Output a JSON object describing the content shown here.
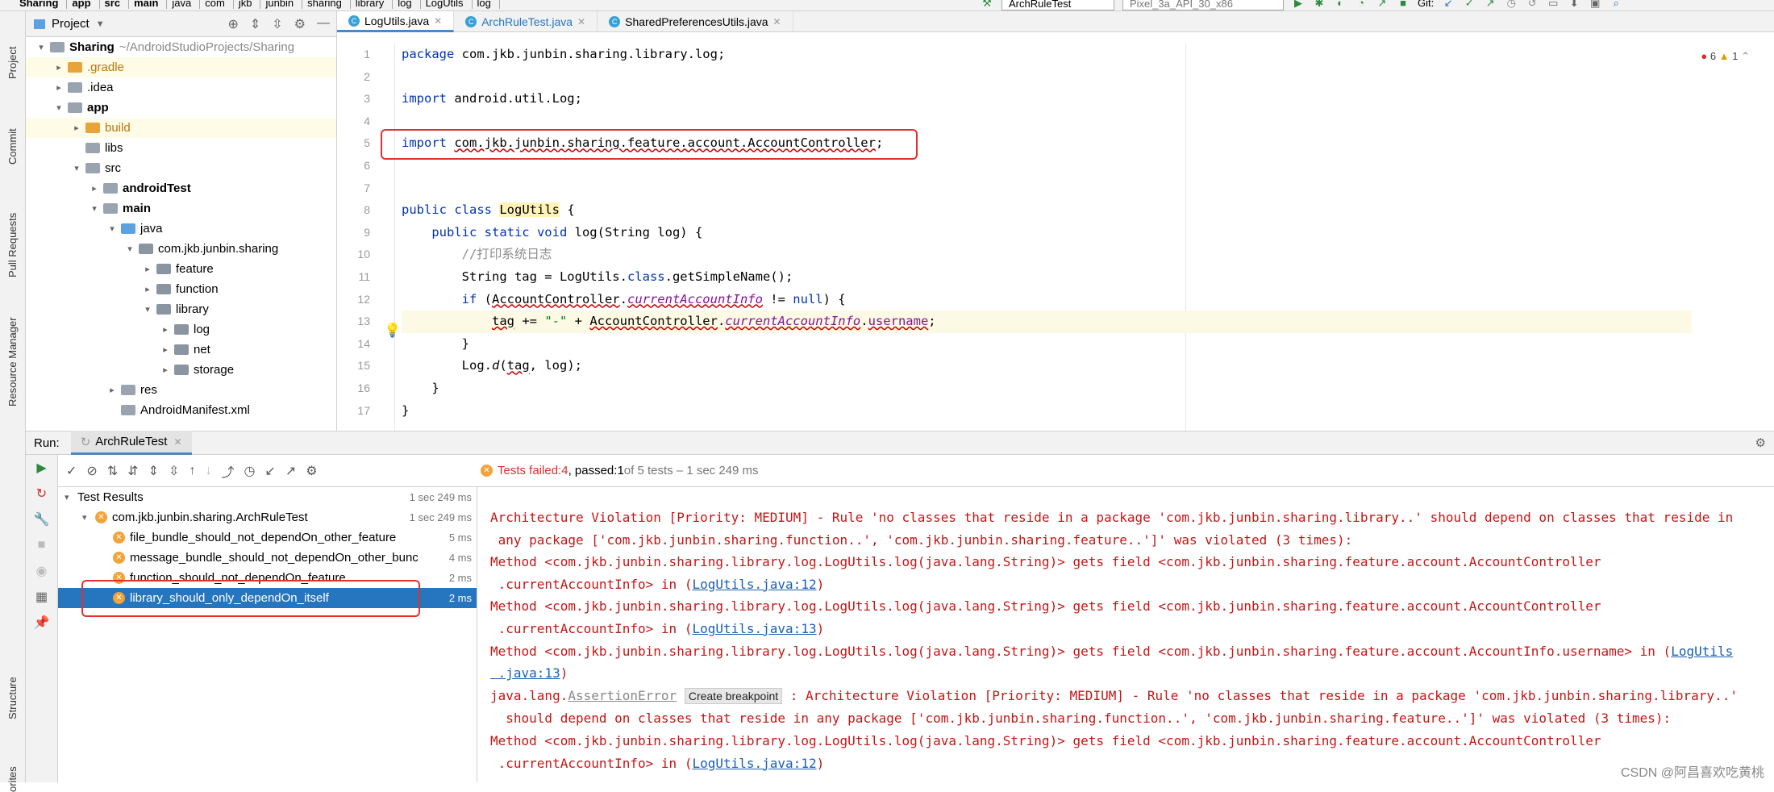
{
  "breadcrumbs": [
    "Sharing",
    "app",
    "src",
    "main",
    "java",
    "com",
    "jkb",
    "junbin",
    "sharing",
    "library",
    "log",
    "LogUtils",
    "log"
  ],
  "run_config": "ArchRuleTest",
  "device": "Pixel_3a_API_30_x86",
  "git_label": "Git:",
  "left_strip": {
    "project": "Project",
    "commit": "Commit",
    "pull_requests": "Pull Requests",
    "resource_manager": "Resource Manager",
    "structure": "Structure",
    "favorites": "orites"
  },
  "project_panel": {
    "title": "Project",
    "tree": [
      {
        "label": "Sharing",
        "suffix": "~/AndroidStudioProjects/Sharing",
        "depth": 0,
        "icon": "module",
        "bold": true,
        "arrow": "down"
      },
      {
        "label": ".gradle",
        "depth": 1,
        "icon": "folder-orange",
        "arrow": "right",
        "sel": true
      },
      {
        "label": ".idea",
        "depth": 1,
        "icon": "folder-grey",
        "arrow": "right"
      },
      {
        "label": "app",
        "depth": 1,
        "icon": "module",
        "bold": true,
        "arrow": "down"
      },
      {
        "label": "build",
        "depth": 2,
        "icon": "folder-orange",
        "arrow": "right",
        "sel": true
      },
      {
        "label": "libs",
        "depth": 2,
        "icon": "folder-grey",
        "arrow": ""
      },
      {
        "label": "src",
        "depth": 2,
        "icon": "folder-grey",
        "arrow": "down"
      },
      {
        "label": "androidTest",
        "depth": 3,
        "icon": "folder-grey",
        "bold": true,
        "arrow": "right"
      },
      {
        "label": "main",
        "depth": 3,
        "icon": "folder-grey",
        "bold": true,
        "arrow": "down"
      },
      {
        "label": "java",
        "depth": 4,
        "icon": "folder-blue",
        "arrow": "down"
      },
      {
        "label": "com.jkb.junbin.sharing",
        "depth": 5,
        "icon": "package",
        "arrow": "down"
      },
      {
        "label": "feature",
        "depth": 6,
        "icon": "package",
        "arrow": "right"
      },
      {
        "label": "function",
        "depth": 6,
        "icon": "package",
        "arrow": "right"
      },
      {
        "label": "library",
        "depth": 6,
        "icon": "package",
        "arrow": "down"
      },
      {
        "label": "log",
        "depth": 7,
        "icon": "package",
        "arrow": "right"
      },
      {
        "label": "net",
        "depth": 7,
        "icon": "package",
        "arrow": "right"
      },
      {
        "label": "storage",
        "depth": 7,
        "icon": "package",
        "arrow": "right"
      },
      {
        "label": "res",
        "depth": 4,
        "icon": "folder-grey",
        "arrow": "right"
      },
      {
        "label": "AndroidManifest.xml",
        "depth": 4,
        "icon": "manifest",
        "arrow": ""
      }
    ]
  },
  "editor": {
    "tabs": [
      {
        "label": "LogUtils.java",
        "active": true
      },
      {
        "label": "ArchRuleTest.java",
        "active": false,
        "color": "#2675bf"
      },
      {
        "label": "SharedPreferencesUtils.java",
        "active": false
      }
    ],
    "inspections": {
      "errors": "6",
      "warnings": "1"
    },
    "line_numbers": [
      "1",
      "2",
      "3",
      "4",
      "5",
      "6",
      "7",
      "8",
      "9",
      "10",
      "11",
      "12",
      "13",
      "14",
      "15",
      "16",
      "17"
    ],
    "code": {
      "l1_kw": "package",
      "l1_rest": " com.jkb.junbin.sharing.library.log;",
      "l3_kw": "import",
      "l3_rest": " android.util.Log;",
      "l5_kw": "import",
      "l5_rest": "com.jkb.junbin.sharing.feature.account.AccountController",
      "l5_semi": ";",
      "l8_kw": "public class",
      "l8_cls": "LogUtils",
      "l8_rest": " {",
      "l9_kw": "public static void",
      "l9_rest": " log(String log) {",
      "l10": "//打印系统日志",
      "l11_a": "String tag = LogUtils.",
      "l11_kw": "class",
      "l11_b": ".getSimpleName();",
      "l12_kw": "if",
      "l12_a": " (",
      "l12_cls": "AccountController",
      "l12_dot": ".",
      "l12_fld": "currentAccountInfo",
      "l12_b": " != ",
      "l12_null": "null",
      "l12_c": ") {",
      "l13_tag": "tag",
      "l13_a": " += ",
      "l13_str": "\"-\"",
      "l13_b": " + ",
      "l13_cls": "AccountController",
      "l13_dot": ".",
      "l13_fld": "currentAccountInfo",
      "l13_dot2": ".",
      "l13_usr": "username",
      "l13_semi": ";",
      "l14": "}",
      "l15_a": "Log.",
      "l15_d": "d",
      "l15_b": "(",
      "l15_tag": "tag",
      "l15_c": ", log);",
      "l16": "}",
      "l17": "}"
    }
  },
  "run": {
    "label": "Run:",
    "tab": "ArchRuleTest",
    "status": {
      "failed_label": "Tests failed: ",
      "failed": "4",
      "passed_label": ", passed: ",
      "passed": "1",
      "rest": " of 5 tests – 1 sec 249 ms"
    },
    "tests": [
      {
        "label": "Test Results",
        "time": "1 sec 249 ms",
        "depth": 0,
        "icon": "none",
        "arrow": "down"
      },
      {
        "label": "com.jkb.junbin.sharing.ArchRuleTest",
        "time": "1 sec 249 ms",
        "depth": 1,
        "icon": "warn",
        "arrow": "down"
      },
      {
        "label": "file_bundle_should_not_dependOn_other_feature",
        "time": "5 ms",
        "depth": 2,
        "icon": "warn"
      },
      {
        "label": "message_bundle_should_not_dependOn_other_bunc",
        "time": "4 ms",
        "depth": 2,
        "icon": "warn"
      },
      {
        "label": "function_should_not_dependOn_feature",
        "time": "2 ms",
        "depth": 2,
        "icon": "warn"
      },
      {
        "label": "library_should_only_dependOn_itself",
        "time": "2 ms",
        "depth": 2,
        "icon": "warn",
        "sel": true
      }
    ],
    "console": {
      "c1": "Architecture Violation [Priority: MEDIUM] - Rule 'no classes that reside in a package 'com.jkb.junbin.sharing.library..' should depend on classes that reside in",
      "c2": " any package ['com.jkb.junbin.sharing.function..', 'com.jkb.junbin.sharing.feature..']' was violated (3 times):",
      "c3": "Method <com.jkb.junbin.sharing.library.log.LogUtils.log(java.lang.String)> gets field <com.jkb.junbin.sharing.feature.account.AccountController",
      "c4a": " .currentAccountInfo> in (",
      "c4l": "LogUtils.java:12",
      "c4b": ")",
      "c5": "Method <com.jkb.junbin.sharing.library.log.LogUtils.log(java.lang.String)> gets field <com.jkb.junbin.sharing.feature.account.AccountController",
      "c6a": " .currentAccountInfo> in (",
      "c6l": "LogUtils.java:13",
      "c6b": ")",
      "c7a": "Method <com.jkb.junbin.sharing.library.log.LogUtils.log(java.lang.String)> gets field <com.jkb.junbin.sharing.feature.account.AccountInfo.username> in (",
      "c7l": "LogUtils",
      "c8l": " .java:13",
      "c8b": ")",
      "c9a": "java.lang.",
      "c9err": "AssertionError",
      "c9tip": "Create breakpoint",
      "c9b": " : Architecture Violation [Priority: MEDIUM] - Rule 'no classes that reside in a package 'com.jkb.junbin.sharing.library..'",
      "c10": "  should depend on classes that reside in any package ['com.jkb.junbin.sharing.function..', 'com.jkb.junbin.sharing.feature..']' was violated (3 times):",
      "c11": "Method <com.jkb.junbin.sharing.library.log.LogUtils.log(java.lang.String)> gets field <com.jkb.junbin.sharing.feature.account.AccountController",
      "c12a": " .currentAccountInfo> in (",
      "c12l": "LogUtils.java:12",
      "c12b": ")"
    }
  },
  "watermark": "CSDN @阿昌喜欢吃黄桃",
  "colors": {
    "accent": "#2675bf",
    "highlight_box": "#e23030",
    "error": "#c41616"
  }
}
